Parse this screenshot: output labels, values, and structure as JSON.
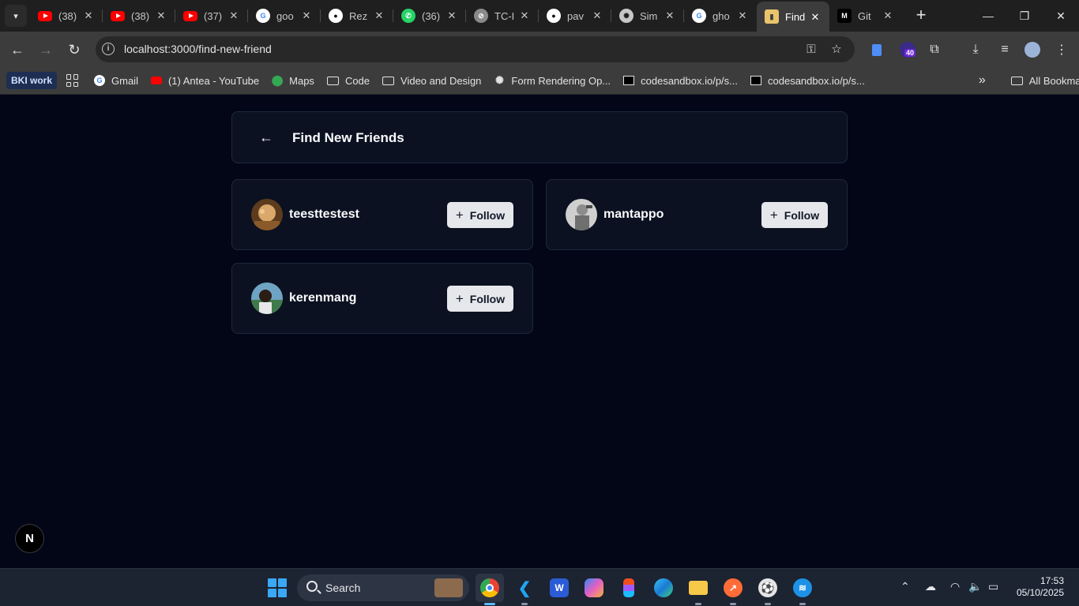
{
  "browser": {
    "tabs": [
      {
        "label": "(38)",
        "icon": "youtube-icon"
      },
      {
        "label": "(38)",
        "icon": "youtube-icon"
      },
      {
        "label": "(37)",
        "icon": "youtube-icon"
      },
      {
        "label": "goo",
        "icon": "google-icon"
      },
      {
        "label": "Rez",
        "icon": "github-icon"
      },
      {
        "label": "(36)",
        "icon": "whatsapp-icon"
      },
      {
        "label": "TC-I",
        "icon": "link-icon"
      },
      {
        "label": "pav",
        "icon": "github-icon"
      },
      {
        "label": "Sim",
        "icon": "openai-icon"
      },
      {
        "label": "gho",
        "icon": "google-icon"
      },
      {
        "label": "Find",
        "icon": "page-favicon-icon",
        "active": true
      },
      {
        "label": "Git",
        "icon": "medium-icon"
      }
    ],
    "close_glyph": "✕",
    "new_tab_glyph": "+",
    "url": "localhost:3000/find-new-friend",
    "extension_badge": "40",
    "bookmarks": {
      "work_label": "BKI work",
      "items": [
        {
          "label": "Gmail",
          "icon": "google-icon"
        },
        {
          "label": "(1) Antea - YouTube",
          "icon": "youtube-icon"
        },
        {
          "label": "Maps",
          "icon": "maps-icon"
        },
        {
          "label": "Code",
          "icon": "folder-icon"
        },
        {
          "label": "Video and Design",
          "icon": "folder-icon"
        },
        {
          "label": "Form Rendering Op...",
          "icon": "openai-icon"
        },
        {
          "label": "codesandbox.io/p/s...",
          "icon": "codesandbox-icon"
        },
        {
          "label": "codesandbox.io/p/s...",
          "icon": "codesandbox-icon"
        }
      ],
      "overflow_glyph": "»",
      "all_bookmarks_label": "All Bookmarks"
    }
  },
  "page": {
    "title": "Find New Friends",
    "back_glyph": "←",
    "follow_label": "Follow",
    "plus_glyph": "+",
    "friends": [
      {
        "username": "teesttestest",
        "avatar_color": "#b98b52"
      },
      {
        "username": "mantappo",
        "avatar_color": "#a8a8a8"
      },
      {
        "username": "kerenmang",
        "avatar_color": "#3f6f58"
      }
    ],
    "next_badge": "N"
  },
  "taskbar": {
    "search_label": "Search",
    "time": "17:53",
    "date": "05/10/2025"
  },
  "colors": {
    "page_bg": "#020617",
    "card_bg": "#0b1120",
    "card_border": "#1e293b",
    "follow_bg": "#e5e7eb"
  }
}
